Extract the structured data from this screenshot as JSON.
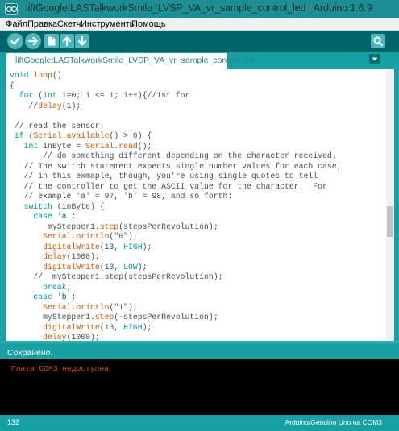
{
  "window": {
    "title": "liftGoogletLASTalkworkSmile_LVSP_VA_vr_sample_control_led | Arduino 1.6.9"
  },
  "menu": {
    "items": [
      "Файл",
      "Правка",
      "Скетч",
      "Инструменты",
      "Помощь"
    ]
  },
  "toolbar": {
    "verify_icon": "checkmark-icon",
    "upload_icon": "arrow-right-icon",
    "new_icon": "new-file-icon",
    "open_icon": "arrow-up-icon",
    "save_icon": "arrow-down-icon",
    "serial_monitor_icon": "magnifier-icon"
  },
  "tabs": [
    {
      "label": "liftGoogletLASTalkworkSmile_LVSP_VA_vr_sample_control_led"
    }
  ],
  "tab_menu_icon": "chevron-down-icon",
  "editor": {
    "lines": [
      [
        [
          "k",
          "void"
        ],
        [
          "p",
          " "
        ],
        [
          "f",
          "loop"
        ],
        [
          "p",
          "()"
        ]
      ],
      [
        [
          "p",
          "{"
        ]
      ],
      [
        [
          "p",
          "  "
        ],
        [
          "k",
          "for"
        ],
        [
          "p",
          " ("
        ],
        [
          "t",
          "int"
        ],
        [
          "p",
          " i=0; i <= 1; i++){//1st for"
        ]
      ],
      [
        [
          "p",
          "    //"
        ],
        [
          "f",
          "delay"
        ],
        [
          "p",
          "(1);"
        ]
      ],
      [
        [
          "p",
          ""
        ]
      ],
      [
        [
          "c",
          " // read the sensor:"
        ]
      ],
      [
        [
          "p",
          " "
        ],
        [
          "k",
          "if"
        ],
        [
          "p",
          " ("
        ],
        [
          "f",
          "Serial"
        ],
        [
          "p",
          "."
        ],
        [
          "f",
          "available"
        ],
        [
          "p",
          "() > 0) {"
        ]
      ],
      [
        [
          "p",
          "   "
        ],
        [
          "t",
          "int"
        ],
        [
          "p",
          " inByte = "
        ],
        [
          "f",
          "Serial"
        ],
        [
          "p",
          "."
        ],
        [
          "f",
          "read"
        ],
        [
          "p",
          "();"
        ]
      ],
      [
        [
          "c",
          "       // do something different depending on the character received."
        ]
      ],
      [
        [
          "c",
          "   // The switch statement expects single number values for each case;"
        ]
      ],
      [
        [
          "c",
          "   // in this exmaple, though, you're using single quotes to tell"
        ]
      ],
      [
        [
          "c",
          "   // the controller to get the ASCII value for the character.  For"
        ]
      ],
      [
        [
          "c",
          "   // example 'a' = 97, 'b' = 98, and so forth:"
        ]
      ],
      [
        [
          "p",
          "   "
        ],
        [
          "k",
          "switch"
        ],
        [
          "p",
          " (inByte) {"
        ]
      ],
      [
        [
          "p",
          "     "
        ],
        [
          "k",
          "case"
        ],
        [
          "p",
          " "
        ],
        [
          "s",
          "'a'"
        ],
        [
          "p",
          ":"
        ]
      ],
      [
        [
          "p",
          "        myStepper1."
        ],
        [
          "f",
          "step"
        ],
        [
          "p",
          "(stepsPerRevolution);"
        ]
      ],
      [
        [
          "p",
          "       "
        ],
        [
          "f",
          "Serial"
        ],
        [
          "p",
          "."
        ],
        [
          "f",
          "println"
        ],
        [
          "p",
          "(\"0\");"
        ]
      ],
      [
        [
          "p",
          "       "
        ],
        [
          "f",
          "digitalWrite"
        ],
        [
          "p",
          "(13, "
        ],
        [
          "t",
          "HIGH"
        ],
        [
          "p",
          ");"
        ]
      ],
      [
        [
          "p",
          "       "
        ],
        [
          "f",
          "delay"
        ],
        [
          "p",
          "(1000);"
        ]
      ],
      [
        [
          "p",
          "       "
        ],
        [
          "f",
          "digitalWrite"
        ],
        [
          "p",
          "(13, "
        ],
        [
          "t",
          "LOW"
        ],
        [
          "p",
          ");"
        ]
      ],
      [
        [
          "p",
          "     //  myStepper1.step(stepsPerRevolution);"
        ]
      ],
      [
        [
          "p",
          "       "
        ],
        [
          "k",
          "break"
        ],
        [
          "p",
          ";"
        ]
      ],
      [
        [
          "p",
          "     "
        ],
        [
          "k",
          "case"
        ],
        [
          "p",
          " "
        ],
        [
          "s",
          "'b'"
        ],
        [
          "p",
          ":"
        ]
      ],
      [
        [
          "p",
          "       "
        ],
        [
          "f",
          "Serial"
        ],
        [
          "p",
          "."
        ],
        [
          "f",
          "println"
        ],
        [
          "p",
          "(\"1\");"
        ]
      ],
      [
        [
          "p",
          "       myStepper1."
        ],
        [
          "f",
          "step"
        ],
        [
          "p",
          "(-stepsPerRevolution);"
        ]
      ],
      [
        [
          "p",
          "       "
        ],
        [
          "f",
          "digitalWrite"
        ],
        [
          "p",
          "(13, "
        ],
        [
          "t",
          "HIGH"
        ],
        [
          "p",
          ");"
        ]
      ],
      [
        [
          "p",
          "       "
        ],
        [
          "f",
          "delay"
        ],
        [
          "p",
          "(1000);"
        ]
      ]
    ]
  },
  "status": {
    "message": "Сохранено."
  },
  "console": {
    "message": "Плата COM3 недоступна"
  },
  "footer": {
    "line_number": "132",
    "board": "Arduino/Genuino Uno на COM3"
  },
  "colors": {
    "teal": "#17a1a5",
    "toolbar": "#006468",
    "keyword": "#00979c",
    "function": "#d35400",
    "error": "#e34c00"
  }
}
